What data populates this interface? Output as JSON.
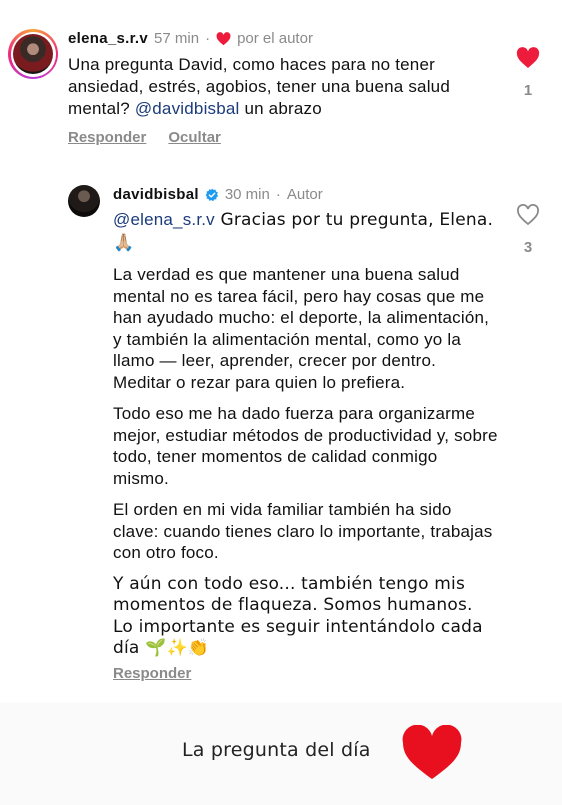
{
  "comment1": {
    "username": "elena_s.r.v",
    "time": "57 min",
    "dot": "·",
    "liked_by_author": "por el autor",
    "text_before_mention": "Una pregunta David, como haces para no tener ansiedad, estrés, agobios, tener una buena salud mental? ",
    "mention": "@davidbisbal",
    "text_after_mention": " un abrazo",
    "reply_label": "Responder",
    "hide_label": "Ocultar",
    "like_count": "1",
    "like_icon": "heart-filled-icon",
    "like_color": "#ed1c3c"
  },
  "comment2": {
    "username": "davidbisbal",
    "time": "30 min",
    "dot": "·",
    "author_label": "Autor",
    "mention": "@elena_s.r.v",
    "p1_after_mention": " Gracias por tu pregunta, Elena. 🙏🏼",
    "p2": "La verdad es que mantener una buena salud mental no es tarea fácil, pero hay cosas que me han ayudado mucho: el deporte, la alimentación, y también la alimentación mental, como yo la llamo — leer, aprender, crecer por dentro. Meditar o rezar para quien lo prefiera.",
    "p3": "Todo eso me ha dado fuerza para organizarme mejor, estudiar métodos de productividad y, sobre todo, tener momentos de calidad conmigo mismo.",
    "p4": "El orden en mi vida familiar también ha sido clave: cuando tienes claro lo importante, trabajas con otro foco.",
    "p5": "Y aún con todo eso... también tengo mis momentos de flaqueza. Somos humanos. Lo importante es seguir intentándolo cada día 🌱✨👏",
    "reply_label": "Responder",
    "like_count": "3",
    "like_icon": "heart-outline-icon",
    "verified_color": "#1d9bf0"
  },
  "footer": {
    "label": "La pregunta del día",
    "heart_icon": "red-heart-icon",
    "heart_color": "#e8101e"
  }
}
